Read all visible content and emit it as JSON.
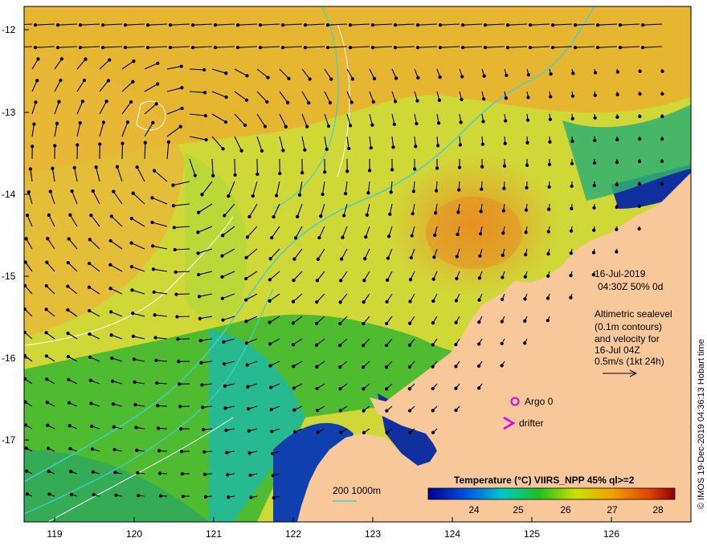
{
  "map": {
    "title_date": "16-Jul-2019",
    "title_time": "04:30Z  50% 0d",
    "altimetry_lines": [
      "Altimetric sealevel",
      "(0.1m contours)",
      "and velocity for",
      "16-Jul 04Z",
      "0.5m/s (1kt 24h)"
    ],
    "legend_argo": "Argo 0",
    "legend_drifter": "drifter",
    "bathy_label": "200  1000m",
    "credit": "© IMOS 19-Dec-2019 04:36:13 Hobart time",
    "colorbar_title": "Temperature (°C) VIIRS_NPP 45% ql>=2",
    "colorbar_ticks": [
      "24",
      "25",
      "26",
      "27",
      "28"
    ],
    "lat_labels": [
      "-12",
      "-13",
      "-14",
      "-15",
      "-16",
      "-17"
    ],
    "lon_labels": [
      "119",
      "120",
      "121",
      "122",
      "123",
      "124",
      "125",
      "126"
    ],
    "colors": {
      "land": "#f9c89a",
      "warm": "#f0a020",
      "mid": "#d8e030",
      "cool": "#30b030",
      "cold": "#0020a0",
      "argo": "#e000e0",
      "bathy": "#40d0d0"
    }
  }
}
